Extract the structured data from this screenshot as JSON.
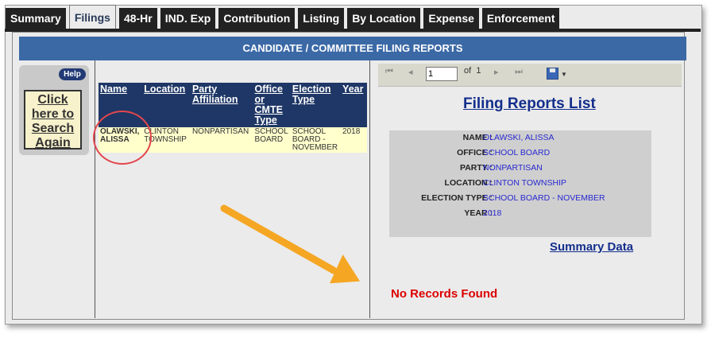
{
  "tabs": [
    {
      "label": "Summary"
    },
    {
      "label": "Filings"
    },
    {
      "label": "48-Hr"
    },
    {
      "label": "IND. Exp"
    },
    {
      "label": "Contribution"
    },
    {
      "label": "Listing"
    },
    {
      "label": "By Location"
    },
    {
      "label": "Expense"
    },
    {
      "label": "Enforcement"
    }
  ],
  "banner": {
    "title": "CANDIDATE / COMMITTEE FILING REPORTS"
  },
  "left": {
    "help_label": "Help",
    "search_again_label": "Click here to Search Again"
  },
  "results": {
    "headers": [
      "Name",
      "Location",
      "Party Affiliation",
      "Office or CMTE Type",
      "Election Type",
      "Year"
    ],
    "rows": [
      [
        "OLAWSKI, ALISSA",
        "CLINTON TOWNSHIP",
        "NONPARTISAN",
        "SCHOOL BOARD",
        "SCHOOL BOARD - NOVEMBER",
        "2018"
      ]
    ]
  },
  "toolbar": {
    "page_value": "1",
    "of_label": "of",
    "total_pages": "1"
  },
  "report": {
    "title": "Filing Reports List",
    "fields": [
      {
        "label": "NAME :",
        "value": "OLAWSKI, ALISSA"
      },
      {
        "label": "OFFICE :",
        "value": "SCHOOL BOARD"
      },
      {
        "label": "PARTY :",
        "value": "NONPARTISAN"
      },
      {
        "label": "LOCATION :",
        "value": "CLINTON TOWNSHIP"
      },
      {
        "label": "ELECTION TYPE :",
        "value": "SCHOOL BOARD - NOVEMBER"
      },
      {
        "label": "YEAR :",
        "value": "2018"
      }
    ],
    "summary_link": "Summary Data",
    "no_records": "No Records Found"
  },
  "colors": {
    "banner": "#3b69a6",
    "header": "#1f3766",
    "row": "#ffffcc",
    "annotation_circle": "#e2474c",
    "annotation_arrow": "#f5a623",
    "no_records": "#dd0000"
  }
}
